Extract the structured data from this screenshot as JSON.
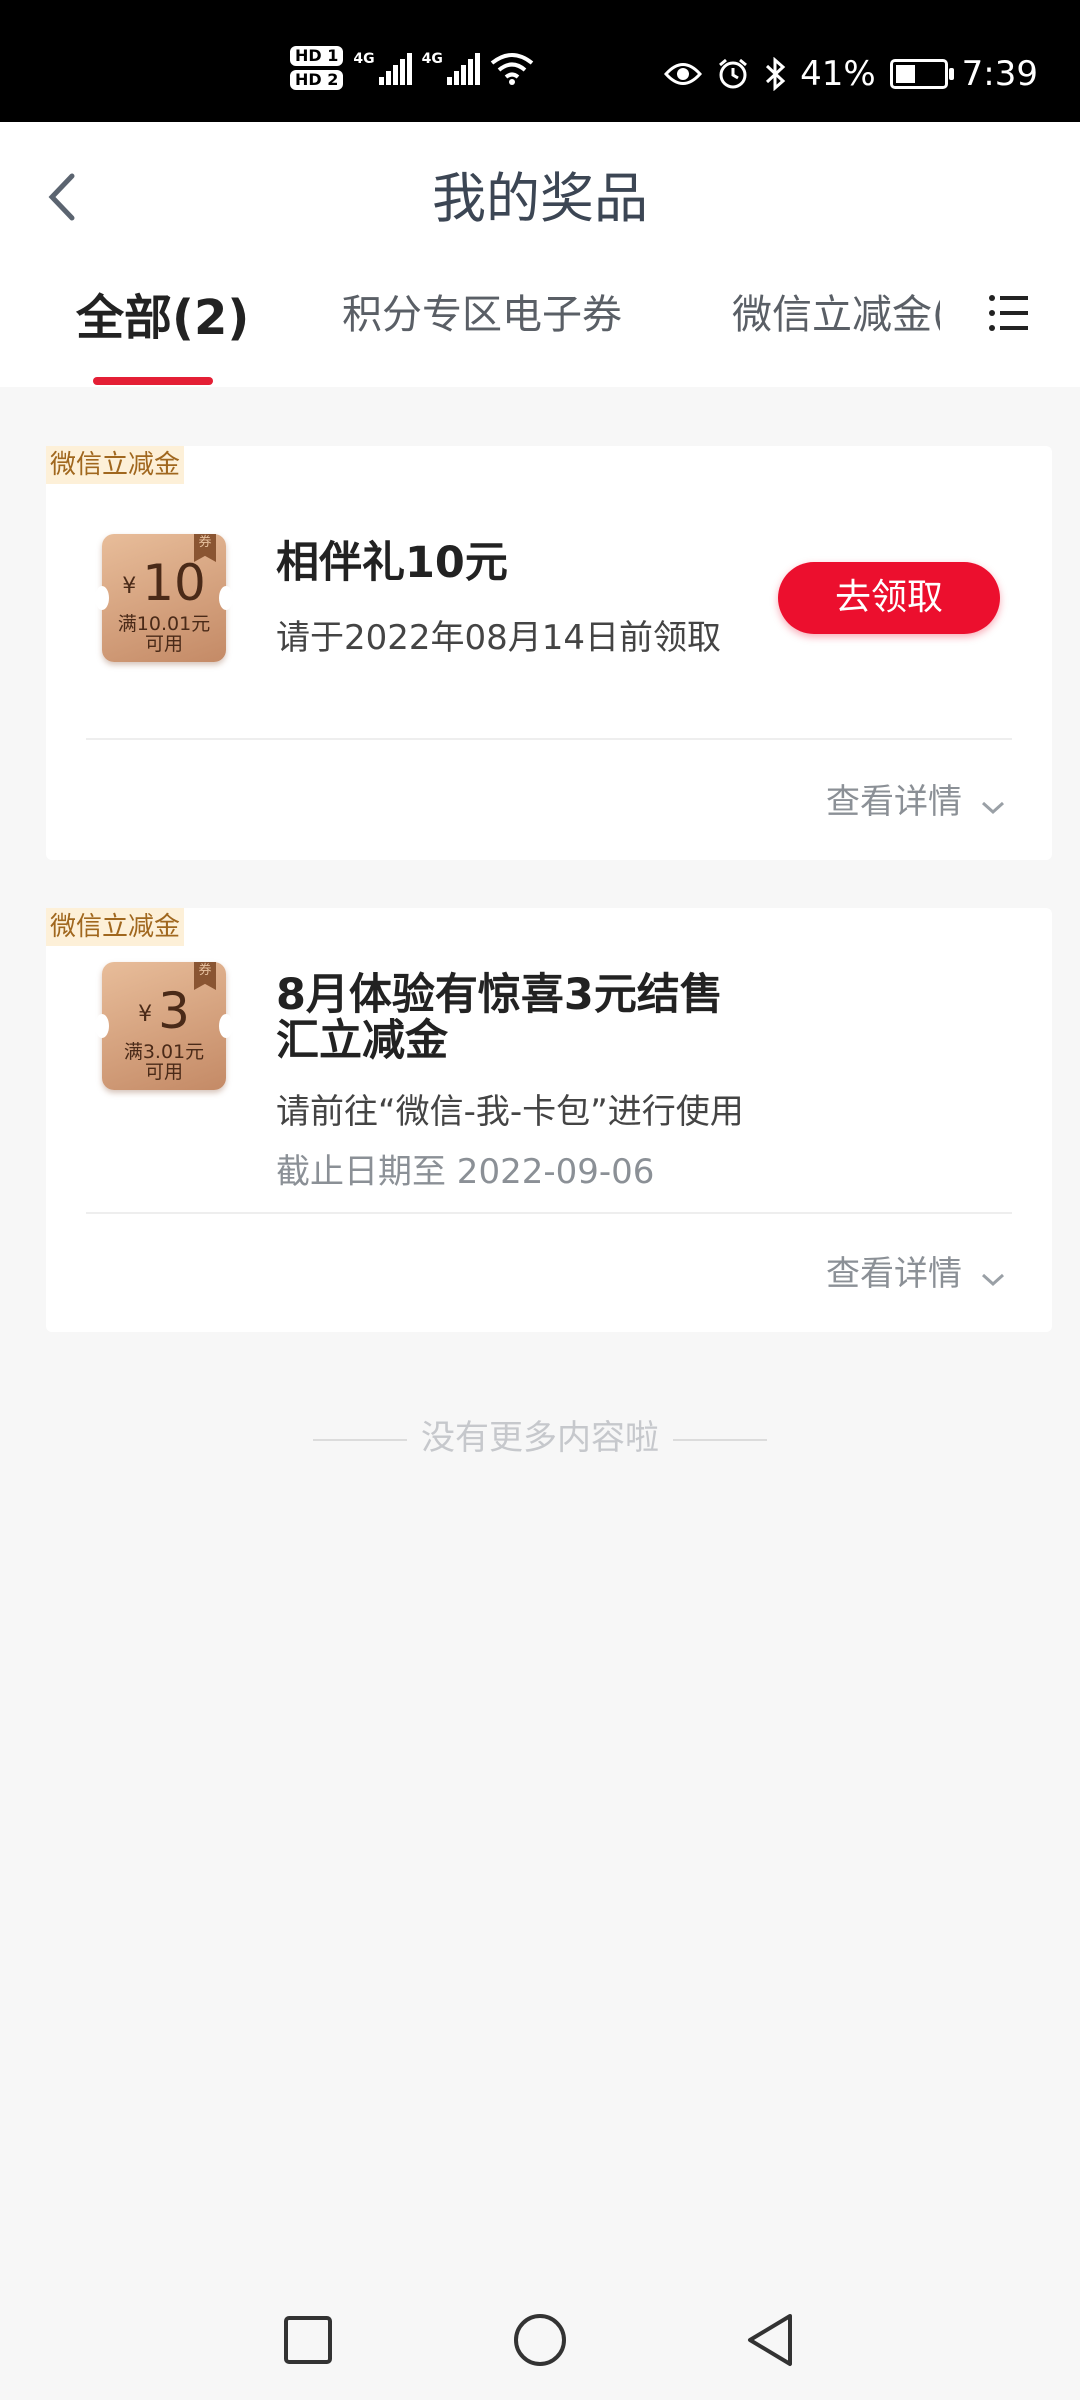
{
  "status_bar": {
    "hd1": "HD 1",
    "hd2": "HD 2",
    "net1": "4G",
    "net2": "4G",
    "battery_percent": "41%",
    "battery_level": 0.41,
    "time": "7:39",
    "icons": [
      "eye-icon",
      "alarm-icon",
      "bluetooth-icon",
      "wifi-icon",
      "battery-icon"
    ]
  },
  "header": {
    "title": "我的奖品",
    "back_icon": "chevron-left-icon"
  },
  "tabs": [
    {
      "label": "全部(2)",
      "active": true
    },
    {
      "label": "积分专区电子券",
      "active": false
    },
    {
      "label": "微信立减金(",
      "active": false
    }
  ],
  "tab_menu_icon": "list-menu-icon",
  "prizes": [
    {
      "tag": "微信立减金",
      "coupon": {
        "currency": "¥",
        "amount": "10",
        "condition_line1": "满10.01元",
        "condition_line2": "可用",
        "ribbon": "券"
      },
      "title": "相伴礼10元",
      "subtitle": "请于2022年08月14日前领取",
      "action": "去领取",
      "details": "查看详情"
    },
    {
      "tag": "微信立减金",
      "coupon": {
        "currency": "¥",
        "amount": "3",
        "condition_line1": "满3.01元",
        "condition_line2": "可用",
        "ribbon": "券"
      },
      "title_line1": "8月体验有惊喜3元结售",
      "title_line2": "汇立减金",
      "subtitle": "请前往“微信-我-卡包”进行使用",
      "expiry": "截止日期至 2022-09-06",
      "details": "查看详情"
    }
  ],
  "footer_note": "没有更多内容啦",
  "nav": {
    "icons": [
      "square-recents-icon",
      "circle-home-icon",
      "triangle-back-icon"
    ]
  },
  "colors": {
    "accent": "#e41f35",
    "button": "#ec0f2e",
    "coupon": "#d4a07c",
    "tag_bg": "#fdf0d8",
    "tag_text": "#a0671e"
  }
}
